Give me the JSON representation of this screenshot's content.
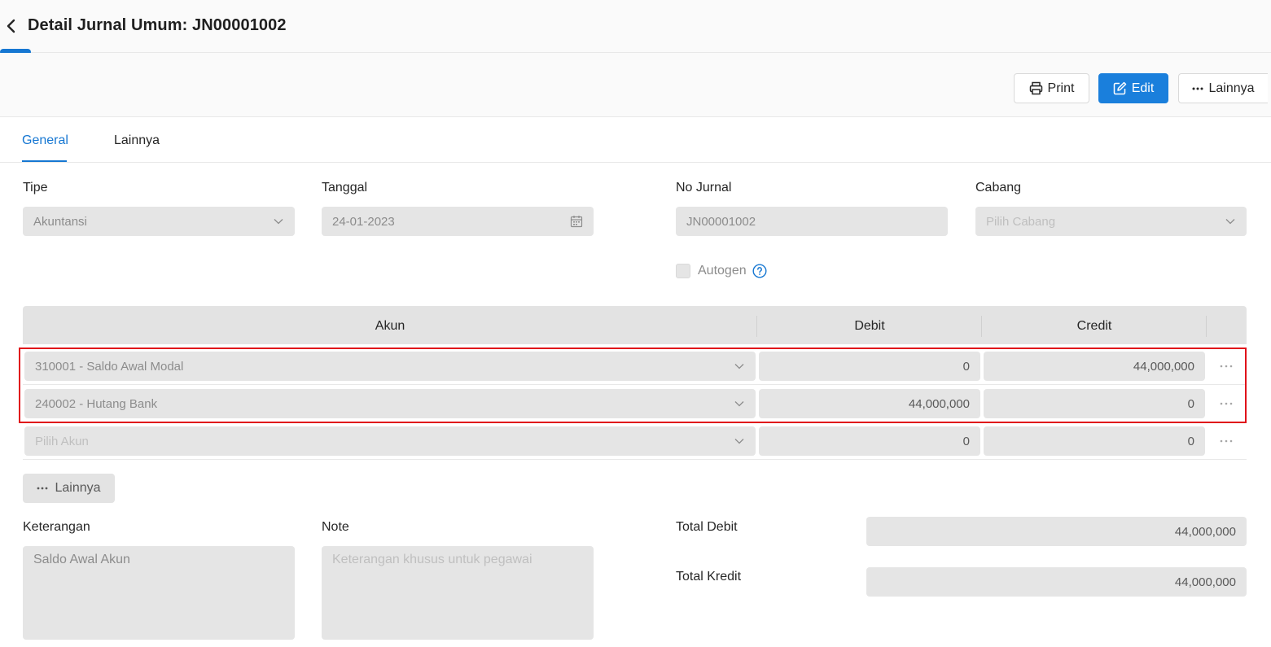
{
  "header": {
    "title": "Detail Jurnal Umum: JN00001002"
  },
  "toolbar": {
    "print_label": "Print",
    "edit_label": "Edit",
    "more_label": "Lainnya"
  },
  "tabs": [
    {
      "label": "General",
      "active": true
    },
    {
      "label": "Lainnya",
      "active": false
    }
  ],
  "form": {
    "tipe": {
      "label": "Tipe",
      "value": "Akuntansi"
    },
    "tanggal": {
      "label": "Tanggal",
      "value": "24-01-2023"
    },
    "no_jurnal": {
      "label": "No Jurnal",
      "value": "JN00001002"
    },
    "cabang": {
      "label": "Cabang",
      "placeholder": "Pilih Cabang"
    },
    "autogen": {
      "label": "Autogen",
      "checked": false
    }
  },
  "grid": {
    "headers": [
      "Akun",
      "Debit",
      "Credit"
    ],
    "rows": [
      {
        "akun": "310001 - Saldo Awal Modal",
        "debit": "0",
        "credit": "44,000,000"
      },
      {
        "akun": "240002 - Hutang Bank",
        "debit": "44,000,000",
        "credit": "0"
      },
      {
        "akun_placeholder": "Pilih Akun",
        "debit": "0",
        "credit": "0"
      }
    ],
    "more_label": "Lainnya"
  },
  "footer": {
    "keterangan": {
      "label": "Keterangan",
      "value": "Saldo Awal Akun"
    },
    "note": {
      "label": "Note",
      "placeholder": "Keterangan khusus untuk pegawai"
    },
    "total_debit": {
      "label": "Total Debit",
      "value": "44,000,000"
    },
    "total_kredit": {
      "label": "Total Kredit",
      "value": "44,000,000"
    }
  },
  "colors": {
    "primary": "#1a7fdc",
    "highlight": "#e0111a",
    "field_bg": "#e5e5e5"
  }
}
